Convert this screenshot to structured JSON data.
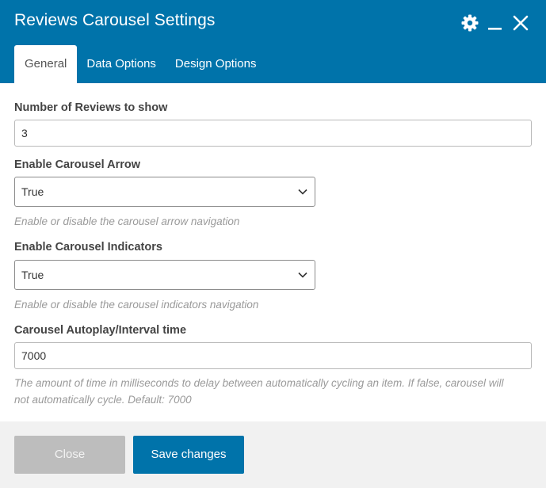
{
  "window": {
    "title": "Reviews Carousel Settings",
    "controls": [
      "gear-icon",
      "minimize-icon",
      "close-icon"
    ]
  },
  "tabs": [
    {
      "label": "General",
      "active": true
    },
    {
      "label": "Data Options",
      "active": false
    },
    {
      "label": "Design Options",
      "active": false
    }
  ],
  "fields": {
    "reviews_count": {
      "label": "Number of Reviews to show",
      "value": "3"
    },
    "carousel_arrow": {
      "label": "Enable Carousel Arrow",
      "value": "True",
      "help": "Enable or disable the carousel arrow navigation"
    },
    "carousel_indicators": {
      "label": "Enable Carousel Indicators",
      "value": "True",
      "help": "Enable or disable the carousel indicators navigation"
    },
    "autoplay_interval": {
      "label": "Carousel Autoplay/Interval time",
      "value": "7000",
      "help_line1": "The amount of time in milliseconds to delay between automatically cycling an item. If false, carousel will",
      "help_line2": "not automatically cycle. Default: 7000"
    }
  },
  "footer": {
    "close_label": "Close",
    "save_label": "Save changes"
  },
  "colors": {
    "accent": "#0073aa",
    "footer_bg": "#f1f1f1",
    "close_button": "#bdbdbd",
    "help_text": "#9a9a9a"
  }
}
